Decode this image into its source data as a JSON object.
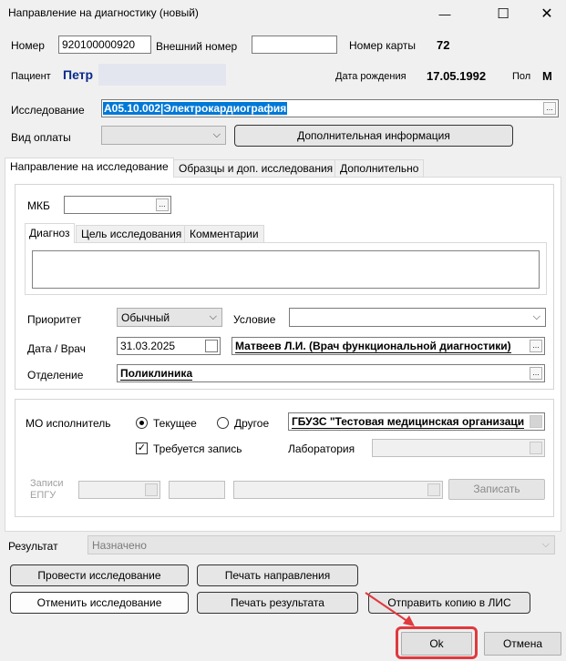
{
  "window": {
    "title": "Направление на диагностику (новый)",
    "minimize_glyph": "—",
    "maximize_glyph": "☐",
    "close_glyph": "✕"
  },
  "header": {
    "number_label": "Номер",
    "number_value": "920100000920",
    "external_number_label": "Внешний номер",
    "external_number_value": "",
    "card_number_label": "Номер карты",
    "card_number_value": "72",
    "patient_label": "Пациент",
    "patient_name": "Петр",
    "birth_date_label": "Дата рождения",
    "birth_date_value": "17.05.1992",
    "sex_label": "Пол",
    "sex_value": "М"
  },
  "study": {
    "label": "Исследование",
    "value": "A05.10.002|Электрокардиография",
    "payment_label": "Вид оплаты",
    "payment_value": "",
    "extra_info_button": "Дополнительная информация"
  },
  "tabs": [
    {
      "label": "Направление на исследование"
    },
    {
      "label": "Образцы и доп. исследования"
    },
    {
      "label": "Дополнительно"
    }
  ],
  "referral": {
    "mkb_label": "МКБ",
    "mkb_value": "",
    "subtabs": [
      {
        "label": "Диагноз"
      },
      {
        "label": "Цель исследования"
      },
      {
        "label": "Комментарии"
      }
    ],
    "diagnosis_text": "",
    "priority_label": "Приоритет",
    "priority_value": "Обычный",
    "condition_label": "Условие",
    "condition_value": "",
    "date_doctor_label": "Дата / Врач",
    "date_value": "31.03.2025",
    "doctor_value": "Матвеев Л.И. (Врач функциональной диагностики)",
    "department_label": "Отделение",
    "department_value": "Поликлиника"
  },
  "executor": {
    "label": "МО исполнитель",
    "current_label": "Текущее",
    "other_label": "Другое",
    "org_value": "ГБУЗС \"Тестовая медицинская организаци",
    "record_required_label": "Требуется запись",
    "lab_label": "Лаборатория",
    "lab_value": "",
    "epgu_label_1": "Записи",
    "epgu_label_2": "ЕПГУ",
    "record_button": "Записать"
  },
  "result": {
    "label": "Результат",
    "value": "Назначено"
  },
  "actions": {
    "conduct_button": "Провести исследование",
    "print_referral_button": "Печать направления",
    "cancel_study_button": "Отменить исследование",
    "print_result_button": "Печать результата",
    "send_lis_button": "Отправить копию в ЛИС",
    "ok_button": "Ok",
    "cancel_button": "Отмена"
  },
  "colors": {
    "selection_bg": "#0078d7",
    "highlight_frame": "#e0393e",
    "patient_link": "#0a2a8c"
  }
}
